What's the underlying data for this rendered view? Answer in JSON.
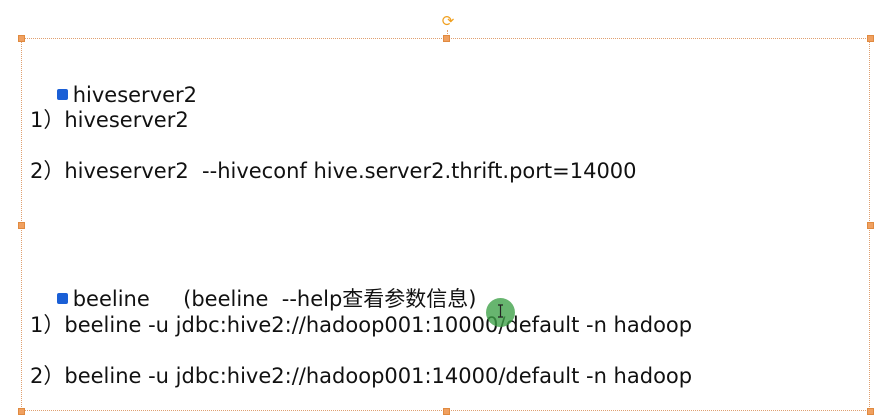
{
  "slide": {
    "section1": {
      "heading": "hiveserver2",
      "item1": "1）hiveserver2",
      "item2": "2）hiveserver2  --hiveconf hive.server2.thrift.port=14000"
    },
    "section2": {
      "heading": "beeline     (beeline  --help查看参数信息)",
      "item1": "1）beeline -u jdbc:hive2://hadoop001:10000/default -n hadoop",
      "item2": "2）beeline -u jdbc:hive2://hadoop001:14000/default -n hadoop"
    }
  },
  "icons": {
    "bullet": "square-bullet-icon",
    "rotate": "rotate-handle-icon",
    "cursor": "text-cursor-icon"
  },
  "colors": {
    "bullet": "#1a5fd6",
    "selection": "#e0a070",
    "cursor_highlight": "#3ca046"
  }
}
